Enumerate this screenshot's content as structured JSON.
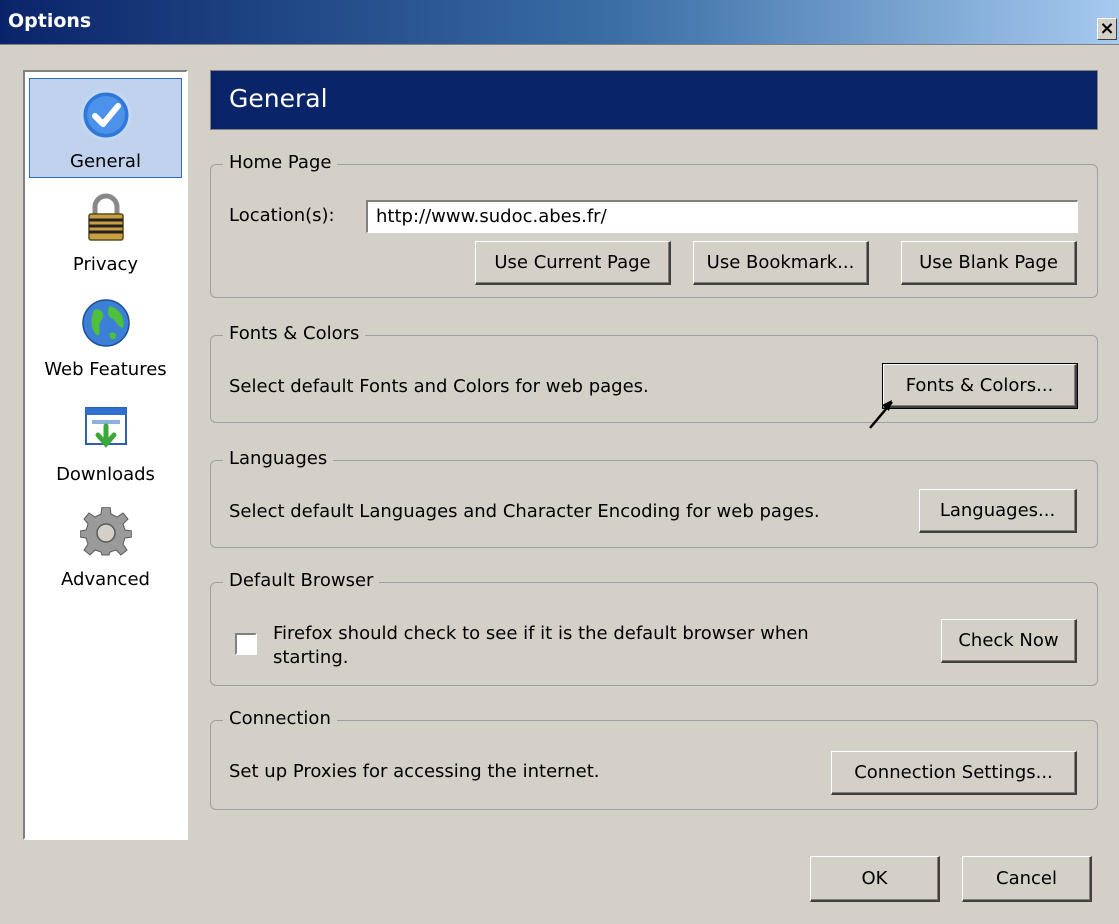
{
  "window": {
    "title": "Options",
    "close_glyph": "×"
  },
  "sidebar": {
    "items": [
      {
        "label": "General",
        "icon": "check-icon",
        "active": true
      },
      {
        "label": "Privacy",
        "icon": "lock-icon",
        "active": false
      },
      {
        "label": "Web Features",
        "icon": "globe-icon",
        "active": false
      },
      {
        "label": "Downloads",
        "icon": "download-icon",
        "active": false
      },
      {
        "label": "Advanced",
        "icon": "gear-icon",
        "active": false
      }
    ]
  },
  "main": {
    "title": "General",
    "home_page": {
      "legend": "Home Page",
      "location_label": "Location(s):",
      "location_value": "http://www.sudoc.abes.fr/",
      "use_current": "Use Current Page",
      "use_bookmark": "Use Bookmark...",
      "use_blank": "Use Blank Page"
    },
    "fonts_colors": {
      "legend": "Fonts & Colors",
      "description": "Select default Fonts and Colors for web pages.",
      "button": "Fonts & Colors..."
    },
    "languages": {
      "legend": "Languages",
      "description": "Select default Languages and Character Encoding for web pages.",
      "button": "Languages..."
    },
    "default_browser": {
      "legend": "Default Browser",
      "checkbox_line1": "Firefox should check to see if it is the default browser when",
      "checkbox_line2": "starting.",
      "checked": false,
      "button": "Check Now"
    },
    "connection": {
      "legend": "Connection",
      "description": "Set up Proxies for accessing the internet.",
      "button": "Connection Settings..."
    }
  },
  "footer": {
    "ok": "OK",
    "cancel": "Cancel"
  },
  "colors": {
    "header_bg": "#0a246a",
    "dialog_bg": "#d4d0c8",
    "selected_bg": "#c1d2ee"
  }
}
